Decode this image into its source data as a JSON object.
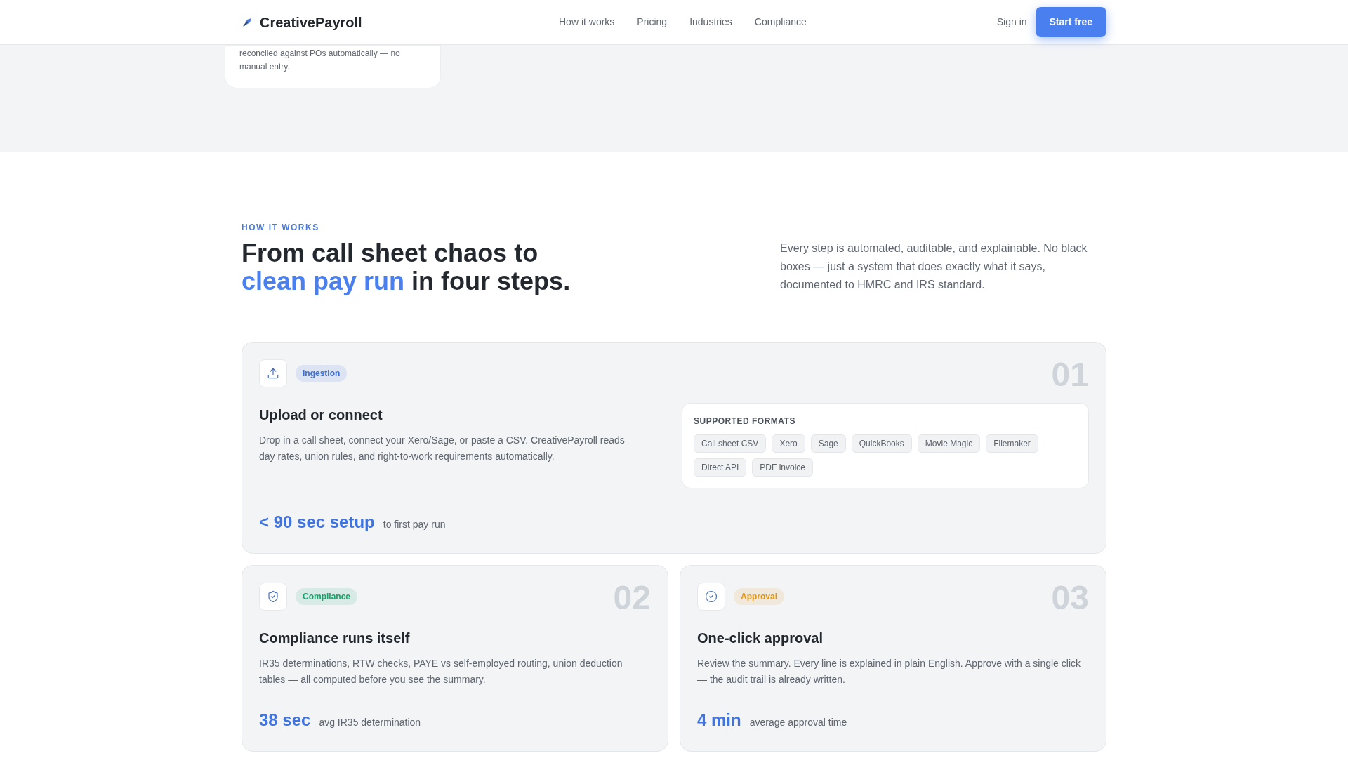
{
  "nav": {
    "brand": "CreativePayroll",
    "links": [
      "How it works",
      "Pricing",
      "Industries",
      "Compliance"
    ],
    "sign_in": "Sign in",
    "cta": "Start free"
  },
  "previous_card": {
    "text": "reconciled against POs automatically — no manual entry."
  },
  "section": {
    "eyebrow": "HOW IT WORKS",
    "heading_line1": "From call sheet chaos to",
    "heading_accent": "clean pay run",
    "heading_rest": "in four steps.",
    "intro": "Every step is automated, auditable, and explainable. No black boxes — just a system that does exactly what it says, documented to HMRC and IRS standard."
  },
  "steps": [
    {
      "kind": "upload",
      "badge": "Ingestion",
      "color": "#3b6fd9",
      "number": "01",
      "title": "Upload or connect",
      "body": "Drop in a call sheet, connect your Xero/Sage, or paste a CSV. CreativePayroll reads day rates, union rules, and right-to-work requirements automatically.",
      "stat": "< 90 sec setup",
      "stat_label": "to first pay run",
      "formats_title": "SUPPORTED FORMATS",
      "formats": [
        "Call sheet CSV",
        "Xero",
        "Sage",
        "QuickBooks",
        "Movie Magic",
        "Filemaker",
        "Direct API",
        "PDF invoice"
      ]
    },
    {
      "kind": "shield",
      "badge": "Compliance",
      "color": "#16a36a",
      "number": "02",
      "title": "Compliance runs itself",
      "body": "IR35 determinations, RTW checks, PAYE vs self-employed routing, union deduction tables — all computed before you see the summary.",
      "stat": "38 sec",
      "stat_label": "avg IR35 determination"
    },
    {
      "kind": "check",
      "badge": "Approval",
      "color": "#e0951a",
      "number": "03",
      "title": "One-click approval",
      "body": "Review the summary. Every line is explained in plain English. Approve with a single click — the audit trail is already written.",
      "stat": "4 min",
      "stat_label": "average approval time"
    }
  ]
}
